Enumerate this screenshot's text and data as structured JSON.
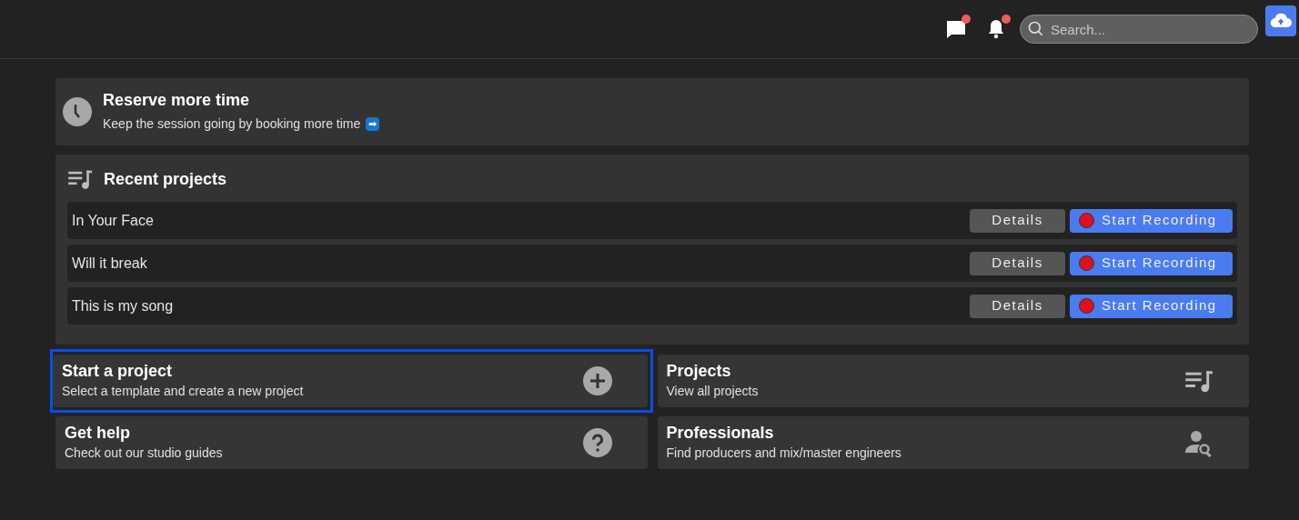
{
  "header": {
    "messages_unread": true,
    "notifications_unread": true,
    "search": {
      "placeholder": "Search..."
    }
  },
  "reserve": {
    "title": "Reserve more time",
    "text": "Keep the session going by booking more time",
    "arrow": "➡"
  },
  "recent": {
    "title": "Recent projects",
    "rows": [
      {
        "name": "In Your Face",
        "details": "Details",
        "record": "Start Recording"
      },
      {
        "name": "Will it break",
        "details": "Details",
        "record": "Start Recording"
      },
      {
        "name": "This is my song",
        "details": "Details",
        "record": "Start Recording"
      }
    ]
  },
  "tiles": [
    {
      "kind": "plus",
      "title": "Start a project",
      "text": "Select a template and create a new project",
      "selected": true
    },
    {
      "kind": "playlist",
      "title": "Projects",
      "text": "View all projects",
      "selected": false
    },
    {
      "kind": "help",
      "title": "Get help",
      "text": "Check out our studio guides",
      "selected": false
    },
    {
      "kind": "people",
      "title": "Professionals",
      "text": "Find producers and mix/master engineers",
      "selected": false
    }
  ]
}
